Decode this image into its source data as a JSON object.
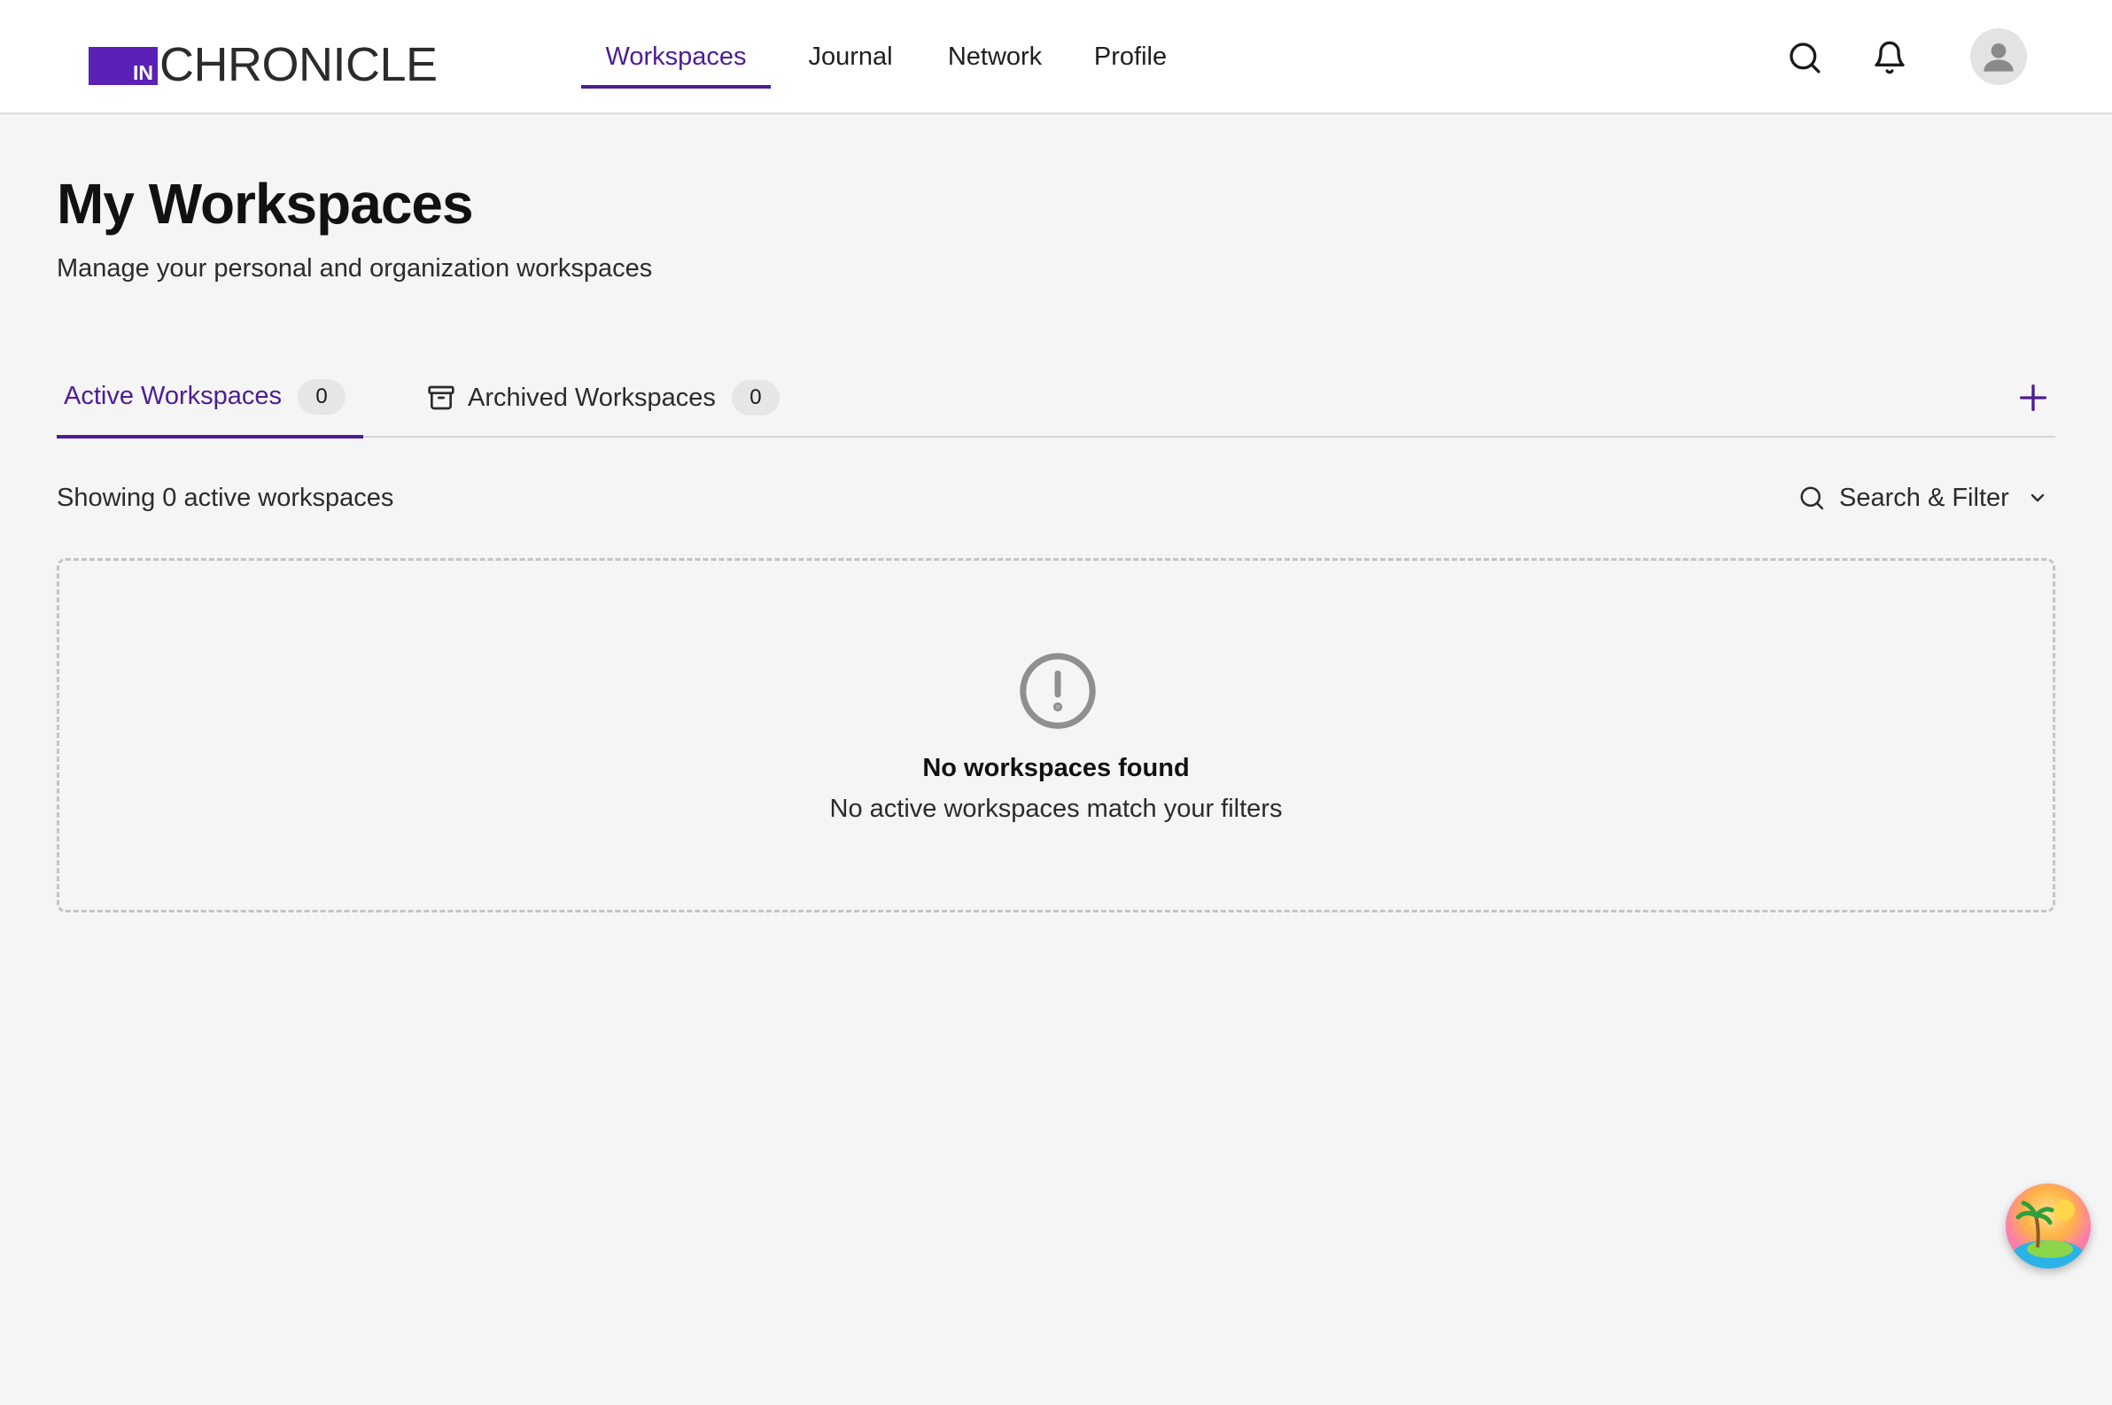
{
  "header": {
    "logo_badge": "IN",
    "logo_text": "CHRONICLE",
    "nav": [
      {
        "label": "Workspaces"
      },
      {
        "label": "Journal"
      },
      {
        "label": "Network"
      },
      {
        "label": "Profile"
      }
    ],
    "icons": {
      "search": "search-icon",
      "notifications": "bell-icon",
      "avatar": "user-avatar-icon"
    }
  },
  "page": {
    "title": "My Workspaces",
    "subtitle": "Manage your personal and organization workspaces"
  },
  "tabs": [
    {
      "label": "Active Workspaces",
      "count": "0",
      "active": true
    },
    {
      "label": "Archived Workspaces",
      "count": "0",
      "icon": "archive-icon",
      "active": false
    }
  ],
  "toolbar": {
    "showing_text": "Showing 0 active workspaces",
    "search_filter_label": "Search & Filter",
    "add_icon": "plus-icon"
  },
  "empty_state": {
    "icon": "alert-circle-icon",
    "title": "No workspaces found",
    "message": "No active workspaces match your filters"
  },
  "colors": {
    "accent": "#4c1d95",
    "brand": "#5b21b6",
    "background": "#f5f5f5",
    "header_bg": "#ffffff"
  }
}
